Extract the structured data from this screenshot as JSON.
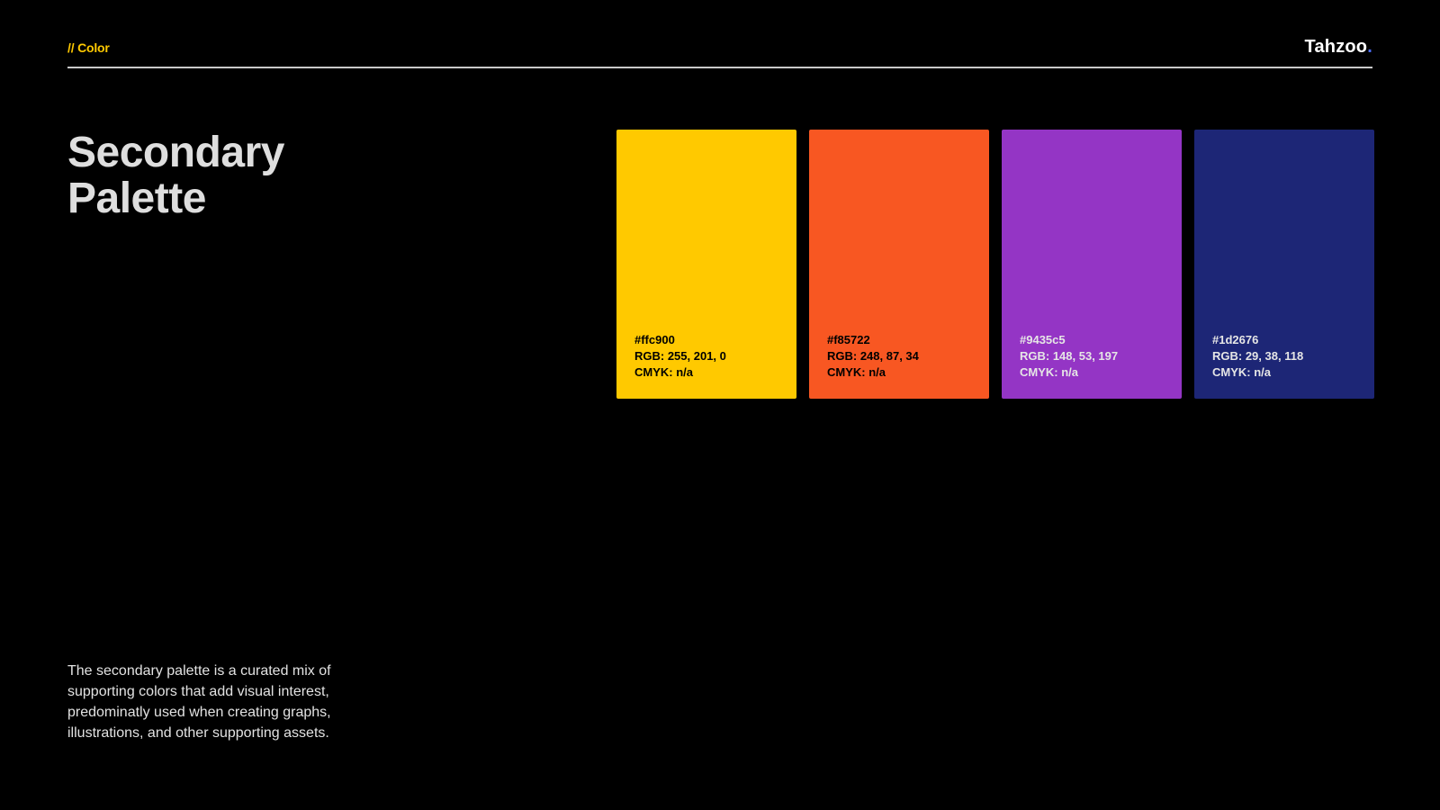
{
  "header": {
    "section_tag": "// Color",
    "brand_name": "Tahzoo",
    "brand_dot": "."
  },
  "title": {
    "line1": "Secondary",
    "line2": "Palette"
  },
  "description": "The secondary palette is a curated mix of supporting colors that add visual interest, predominatly used when creating graphs, illustrations, and other supporting assets.",
  "swatches": [
    {
      "hex": "#ffc900",
      "rgb": "RGB: 255, 201, 0",
      "cmyk": "CMYK: n/a",
      "color": "#ffc900",
      "text_color": "#000000"
    },
    {
      "hex": "#f85722",
      "rgb": "RGB: 248, 87, 34",
      "cmyk": "CMYK: n/a",
      "color": "#f85722",
      "text_color": "#000000"
    },
    {
      "hex": "#9435c5",
      "rgb": "RGB: 148, 53, 197",
      "cmyk": "CMYK: n/a",
      "color": "#9435c5",
      "text_color": "#e6e6e6"
    },
    {
      "hex": "#1d2676",
      "rgb": "RGB: 29, 38, 118",
      "cmyk": "CMYK: n/a",
      "color": "#1d2676",
      "text_color": "#e6e6e6"
    }
  ],
  "colors": {
    "background": "#000000",
    "accent": "#ffc900",
    "brand_dot": "#4a6cf7",
    "rule": "#c9c9c9"
  }
}
